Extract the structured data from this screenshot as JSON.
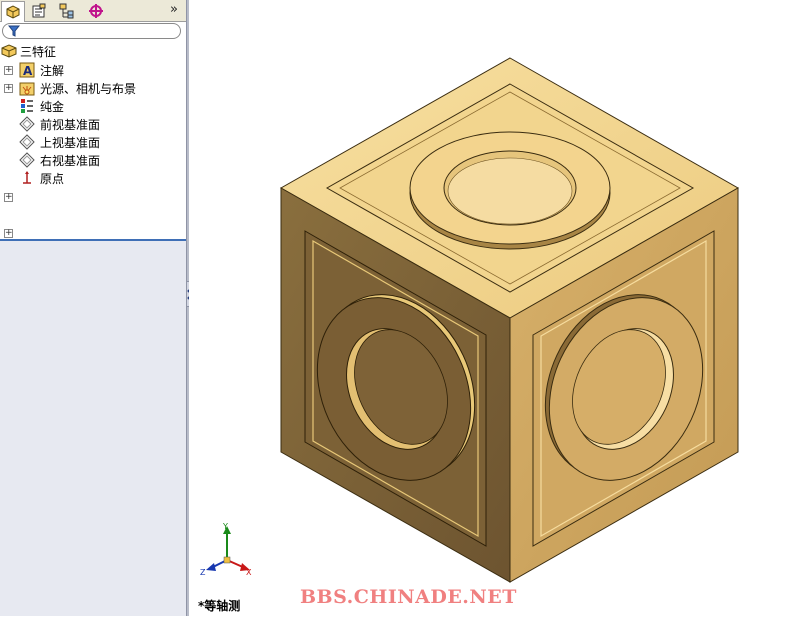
{
  "feature_tabs": [
    {
      "icon": "feature-manager-icon",
      "active": true
    },
    {
      "icon": "property-manager-icon",
      "active": false
    },
    {
      "icon": "configuration-manager-icon",
      "active": false
    },
    {
      "icon": "dimxpert-manager-icon",
      "active": false
    }
  ],
  "more_tabs_glyph": "»",
  "filter_icon": "funnel-icon",
  "tree": {
    "root": "三特征",
    "items": [
      {
        "label": "注解",
        "icon": "annotation-icon",
        "expander": "+"
      },
      {
        "label": "光源、相机与布景",
        "icon": "lights-icon",
        "expander": "+"
      },
      {
        "label": "纯金",
        "icon": "material-icon",
        "expander": ""
      },
      {
        "label": "前视基准面",
        "icon": "plane-icon",
        "expander": ""
      },
      {
        "label": "上视基准面",
        "icon": "plane-icon",
        "expander": ""
      },
      {
        "label": "右视基准面",
        "icon": "plane-icon",
        "expander": ""
      },
      {
        "label": "原点",
        "icon": "origin-icon",
        "expander": ""
      }
    ],
    "extra_expanders": [
      "+",
      "+"
    ]
  },
  "viewport": {
    "view_name": "*等轴测",
    "triad_labels": {
      "x": "X",
      "y": "Y",
      "z": "Z"
    },
    "model_color": "#f1d08a"
  },
  "watermark": "BBS.CHINADE.NET"
}
